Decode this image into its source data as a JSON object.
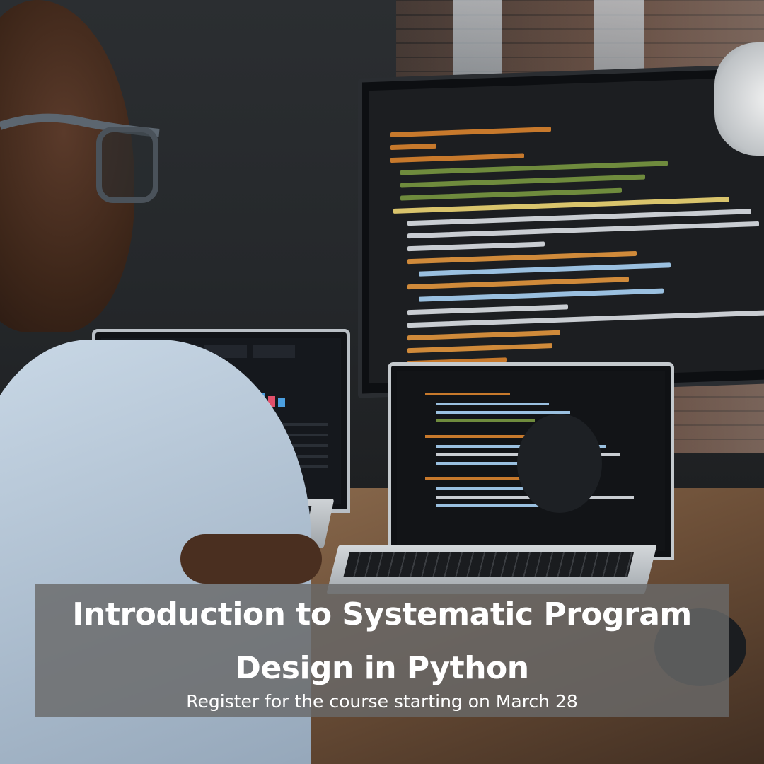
{
  "banner": {
    "title_line1": "Introduction to Systematic Program",
    "title_line2": "Design in Python",
    "subtitle": "Register for the course starting on March 28"
  },
  "colors": {
    "banner_bg": "#696969",
    "text": "#ffffff"
  }
}
